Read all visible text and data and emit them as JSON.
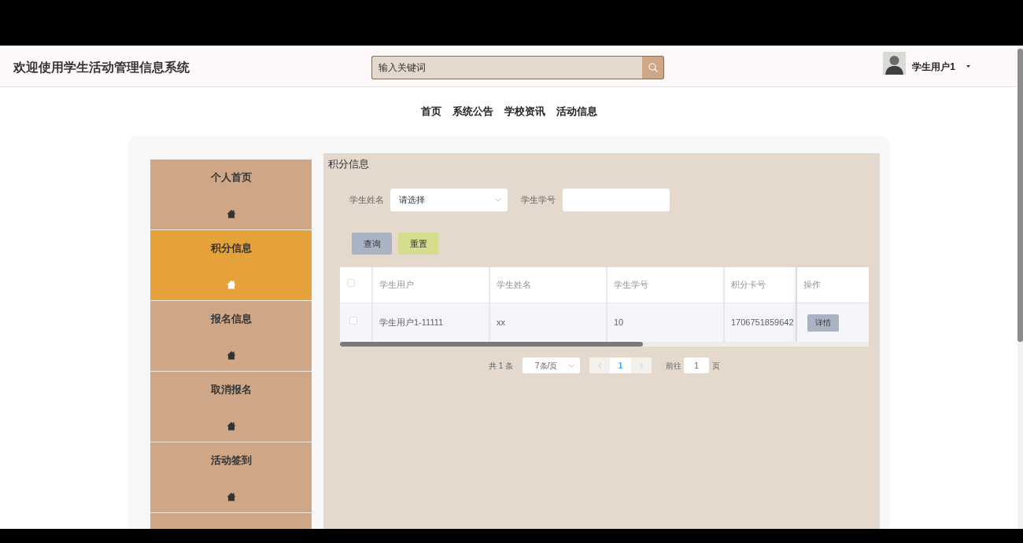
{
  "header": {
    "title": "欢迎使用学生活动管理信息系统",
    "search": {
      "placeholder": "输入关键词"
    },
    "user": {
      "name": "学生用户1"
    }
  },
  "nav": [
    "首页",
    "系统公告",
    "学校资讯",
    "活动信息"
  ],
  "sidebar": {
    "items": [
      {
        "label": "个人首页",
        "selected": false
      },
      {
        "label": "积分信息",
        "selected": true
      },
      {
        "label": "报名信息",
        "selected": false
      },
      {
        "label": "取消报名",
        "selected": false
      },
      {
        "label": "活动签到",
        "selected": false
      }
    ]
  },
  "panel": {
    "title": "积分信息",
    "filters": [
      {
        "kind": "select",
        "label": "学生姓名",
        "placeholder": "请选择"
      },
      {
        "kind": "input",
        "label": "学生学号"
      }
    ],
    "buttons": [
      {
        "kind": "query",
        "label": "查询"
      },
      {
        "kind": "reset",
        "label": "重置"
      }
    ],
    "table": {
      "select_all": {
        "checked": false
      },
      "columns": [
        "学生用户",
        "学生姓名",
        "学生学号",
        "积分卡号",
        "操作"
      ],
      "rows": [
        {
          "checked": false,
          "cells": [
            "学生用户1-11111",
            "xx",
            "10",
            "1706751859642"
          ],
          "action": "详情"
        }
      ]
    },
    "pagination": {
      "total": "共 1 条",
      "page_size": "7条/页",
      "pages": [
        {
          "label": "1",
          "selected": true
        }
      ],
      "goto_label": "前往",
      "goto_value": "1",
      "suffix": "页"
    }
  }
}
